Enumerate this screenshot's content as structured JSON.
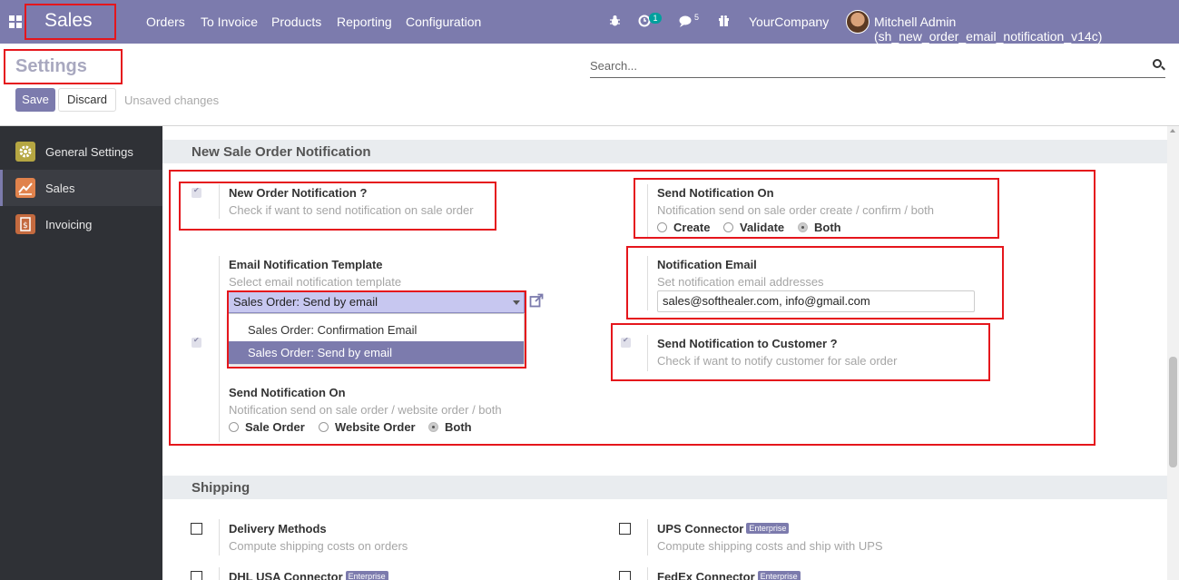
{
  "navbar": {
    "app_name": "Sales",
    "menu": [
      "Orders",
      "To Invoice",
      "Products",
      "Reporting",
      "Configuration"
    ],
    "activity_count": "1",
    "message_count": "5",
    "company": "YourCompany",
    "user": "Mitchell Admin (sh_new_order_email_notification_v14c)",
    "icons": [
      "apps-icon",
      "bug-icon",
      "activity-clock-icon",
      "chat-icon",
      "gift-icon"
    ]
  },
  "control_panel": {
    "title": "Settings",
    "search_placeholder": "Search...",
    "save_label": "Save",
    "discard_label": "Discard",
    "status": "Unsaved changes"
  },
  "sidebar": {
    "items": [
      {
        "label": "General Settings",
        "icon": "gear-icon",
        "color": "#b5a642"
      },
      {
        "label": "Sales",
        "icon": "chart-icon",
        "color": "#e0824c"
      },
      {
        "label": "Invoicing",
        "icon": "invoice-icon",
        "color": "#c46a3f"
      }
    ]
  },
  "notification_section": {
    "title": "New Sale Order Notification",
    "new_order": {
      "label": "New Order Notification ?",
      "hint": "Check if want to send notification on sale order"
    },
    "send_on_admin": {
      "label": "Send Notification On",
      "hint": "Notification send on sale order create / confirm / both",
      "options": [
        "Create",
        "Validate",
        "Both"
      ],
      "selected": "Both"
    },
    "template": {
      "label": "Email Notification Template",
      "hint": "Select email notification template",
      "value": "Sales Order: Send by email",
      "options": [
        "Sales Order: Confirmation Email",
        "Sales Order: Send by email"
      ]
    },
    "email": {
      "label": "Notification Email",
      "hint": "Set notification email addresses",
      "value": "sales@softhealer.com, info@gmail.com"
    },
    "customer": {
      "label": "Send Notification to Customer ?",
      "hint": "Check if want to notify customer for sale order"
    },
    "send_on_customer": {
      "label": "Send Notification On",
      "hint": "Notification send on sale order / website order / both",
      "options": [
        "Sale Order",
        "Website Order",
        "Both"
      ],
      "selected": "Both"
    }
  },
  "shipping_section": {
    "title": "Shipping",
    "delivery": {
      "label": "Delivery Methods",
      "hint": "Compute shipping costs on orders"
    },
    "ups": {
      "label": "UPS Connector",
      "badge": "Enterprise",
      "hint": "Compute shipping costs and ship with UPS"
    },
    "dhl": {
      "label": "DHL USA Connector",
      "badge": "Enterprise"
    },
    "fedex": {
      "label": "FedEx Connector",
      "badge": "Enterprise"
    }
  },
  "colors": {
    "accent": "#7c7bad",
    "highlight": "#e5161c",
    "sidebar": "#2f3136"
  }
}
